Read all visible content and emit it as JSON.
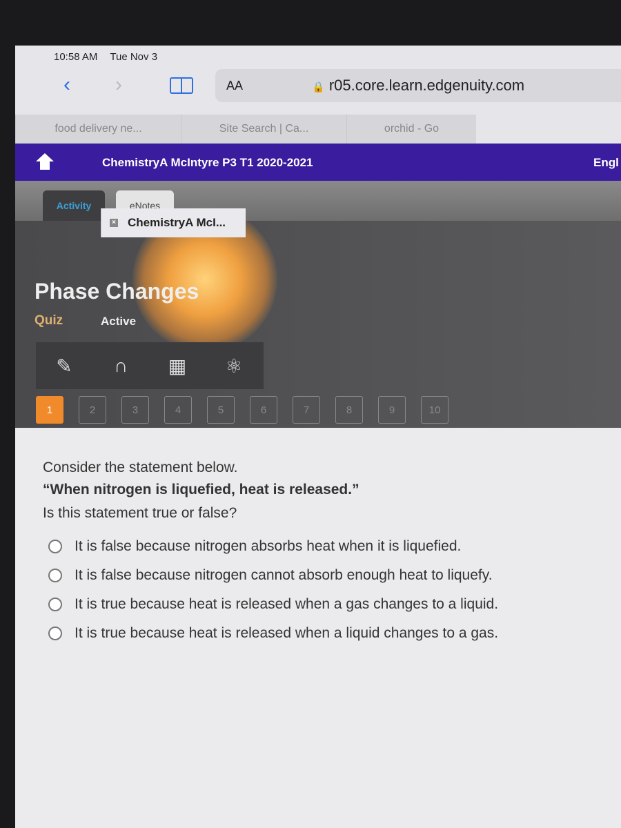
{
  "status": {
    "time": "10:58 AM",
    "date": "Tue Nov 3"
  },
  "browser": {
    "text_size": "AA",
    "url": "r05.core.learn.edgenuity.com",
    "tabs": [
      {
        "label": "ChemistryA McI..."
      },
      {
        "label": "food delivery ne..."
      },
      {
        "label": "Site Search | Ca..."
      },
      {
        "label": "orchid - Go"
      }
    ]
  },
  "header": {
    "course": "ChemistryA McIntyre P3 T1 2020-2021",
    "language": "Engl"
  },
  "subtabs": [
    "Activity",
    "eNotes"
  ],
  "activity": {
    "title": "Phase Changes",
    "type": "Quiz",
    "status": "Active",
    "tools": [
      "pencil-icon",
      "headphones-icon",
      "calculator-icon",
      "atom-icon"
    ],
    "questions": [
      "1",
      "2",
      "3",
      "4",
      "5",
      "6",
      "7",
      "8",
      "9",
      "10"
    ],
    "current": "1"
  },
  "question": {
    "intro": "Consider the statement below.",
    "statement": "“When nitrogen is liquefied, heat is released.”",
    "prompt": "Is this statement true or false?",
    "options": [
      "It is false because nitrogen absorbs heat when it is liquefied.",
      "It is false because nitrogen cannot absorb enough heat to liquefy.",
      "It is true because heat is released when a gas changes to a liquid.",
      "It is true because heat is released when a liquid changes to a gas."
    ]
  },
  "colors": {
    "header": "#3a1c9e",
    "accent": "#f08a2a",
    "link": "#2f6fe0"
  }
}
